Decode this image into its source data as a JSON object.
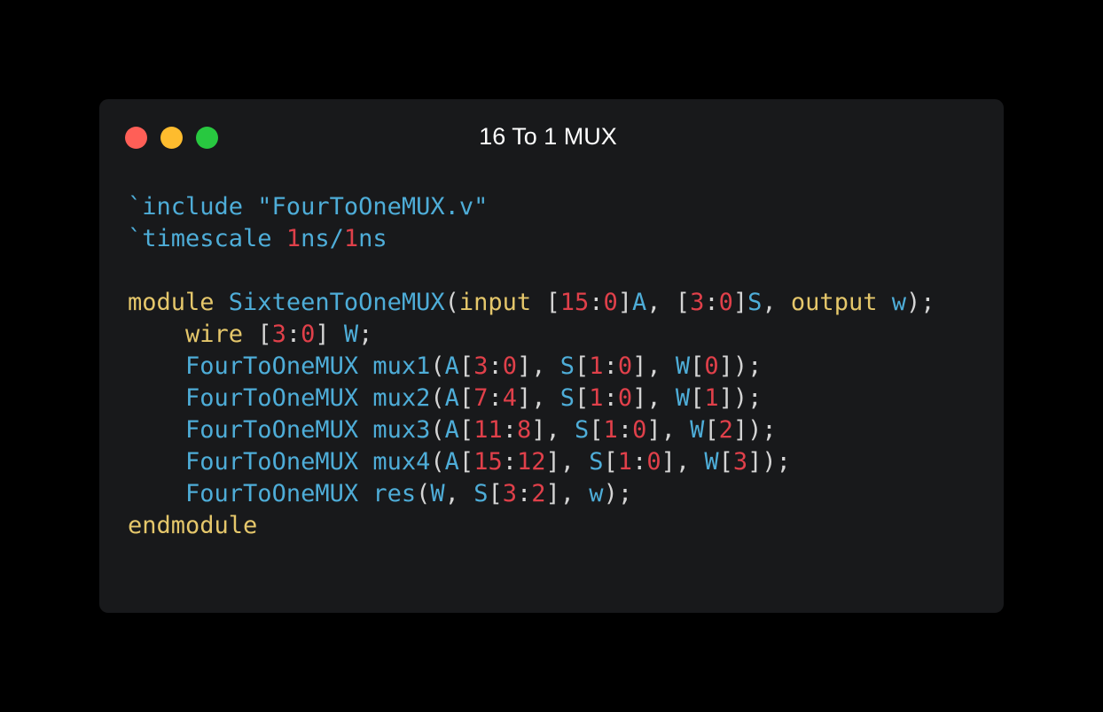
{
  "window": {
    "title": "16 To 1 MUX",
    "controls": {
      "close_color": "#ff5f57",
      "minimize_color": "#febc2e",
      "maximize_color": "#28c840"
    }
  },
  "colors": {
    "kw": "#e5c76b",
    "id": "#4eadd8",
    "num": "#e0404a",
    "punct": "#d4d4d4"
  },
  "code": {
    "language": "verilog",
    "lines": [
      [
        [
          "kw-id",
          "`include \"FourToOneMUX.v\""
        ]
      ],
      [
        [
          "id",
          "`timescale "
        ],
        [
          "num",
          "1"
        ],
        [
          "id",
          "ns/"
        ],
        [
          "num",
          "1"
        ],
        [
          "id",
          "ns"
        ]
      ],
      [],
      [
        [
          "kw",
          "module "
        ],
        [
          "id",
          "SixteenToOneMUX"
        ],
        [
          "punct",
          "("
        ],
        [
          "kw",
          "input "
        ],
        [
          "punct",
          "["
        ],
        [
          "num",
          "15"
        ],
        [
          "punct",
          ":"
        ],
        [
          "num",
          "0"
        ],
        [
          "punct",
          "]"
        ],
        [
          "id",
          "A"
        ],
        [
          "punct",
          ", ["
        ],
        [
          "num",
          "3"
        ],
        [
          "punct",
          ":"
        ],
        [
          "num",
          "0"
        ],
        [
          "punct",
          "]"
        ],
        [
          "id",
          "S"
        ],
        [
          "punct",
          ", "
        ],
        [
          "kw",
          "output "
        ],
        [
          "id",
          "w"
        ],
        [
          "punct",
          ");"
        ]
      ],
      [
        [
          "punct",
          "    "
        ],
        [
          "kw",
          "wire "
        ],
        [
          "punct",
          "["
        ],
        [
          "num",
          "3"
        ],
        [
          "punct",
          ":"
        ],
        [
          "num",
          "0"
        ],
        [
          "punct",
          "] "
        ],
        [
          "id",
          "W"
        ],
        [
          "punct",
          ";"
        ]
      ],
      [
        [
          "punct",
          "    "
        ],
        [
          "id",
          "FourToOneMUX "
        ],
        [
          "id",
          "mux1"
        ],
        [
          "punct",
          "("
        ],
        [
          "id",
          "A"
        ],
        [
          "punct",
          "["
        ],
        [
          "num",
          "3"
        ],
        [
          "punct",
          ":"
        ],
        [
          "num",
          "0"
        ],
        [
          "punct",
          "], "
        ],
        [
          "id",
          "S"
        ],
        [
          "punct",
          "["
        ],
        [
          "num",
          "1"
        ],
        [
          "punct",
          ":"
        ],
        [
          "num",
          "0"
        ],
        [
          "punct",
          "], "
        ],
        [
          "id",
          "W"
        ],
        [
          "punct",
          "["
        ],
        [
          "num",
          "0"
        ],
        [
          "punct",
          "]);"
        ]
      ],
      [
        [
          "punct",
          "    "
        ],
        [
          "id",
          "FourToOneMUX "
        ],
        [
          "id",
          "mux2"
        ],
        [
          "punct",
          "("
        ],
        [
          "id",
          "A"
        ],
        [
          "punct",
          "["
        ],
        [
          "num",
          "7"
        ],
        [
          "punct",
          ":"
        ],
        [
          "num",
          "4"
        ],
        [
          "punct",
          "], "
        ],
        [
          "id",
          "S"
        ],
        [
          "punct",
          "["
        ],
        [
          "num",
          "1"
        ],
        [
          "punct",
          ":"
        ],
        [
          "num",
          "0"
        ],
        [
          "punct",
          "], "
        ],
        [
          "id",
          "W"
        ],
        [
          "punct",
          "["
        ],
        [
          "num",
          "1"
        ],
        [
          "punct",
          "]);"
        ]
      ],
      [
        [
          "punct",
          "    "
        ],
        [
          "id",
          "FourToOneMUX "
        ],
        [
          "id",
          "mux3"
        ],
        [
          "punct",
          "("
        ],
        [
          "id",
          "A"
        ],
        [
          "punct",
          "["
        ],
        [
          "num",
          "11"
        ],
        [
          "punct",
          ":"
        ],
        [
          "num",
          "8"
        ],
        [
          "punct",
          "], "
        ],
        [
          "id",
          "S"
        ],
        [
          "punct",
          "["
        ],
        [
          "num",
          "1"
        ],
        [
          "punct",
          ":"
        ],
        [
          "num",
          "0"
        ],
        [
          "punct",
          "], "
        ],
        [
          "id",
          "W"
        ],
        [
          "punct",
          "["
        ],
        [
          "num",
          "2"
        ],
        [
          "punct",
          "]);"
        ]
      ],
      [
        [
          "punct",
          "    "
        ],
        [
          "id",
          "FourToOneMUX "
        ],
        [
          "id",
          "mux4"
        ],
        [
          "punct",
          "("
        ],
        [
          "id",
          "A"
        ],
        [
          "punct",
          "["
        ],
        [
          "num",
          "15"
        ],
        [
          "punct",
          ":"
        ],
        [
          "num",
          "12"
        ],
        [
          "punct",
          "], "
        ],
        [
          "id",
          "S"
        ],
        [
          "punct",
          "["
        ],
        [
          "num",
          "1"
        ],
        [
          "punct",
          ":"
        ],
        [
          "num",
          "0"
        ],
        [
          "punct",
          "], "
        ],
        [
          "id",
          "W"
        ],
        [
          "punct",
          "["
        ],
        [
          "num",
          "3"
        ],
        [
          "punct",
          "]);"
        ]
      ],
      [
        [
          "punct",
          "    "
        ],
        [
          "id",
          "FourToOneMUX "
        ],
        [
          "id",
          "res"
        ],
        [
          "punct",
          "("
        ],
        [
          "id",
          "W"
        ],
        [
          "punct",
          ", "
        ],
        [
          "id",
          "S"
        ],
        [
          "punct",
          "["
        ],
        [
          "num",
          "3"
        ],
        [
          "punct",
          ":"
        ],
        [
          "num",
          "2"
        ],
        [
          "punct",
          "], "
        ],
        [
          "id",
          "w"
        ],
        [
          "punct",
          ");"
        ]
      ],
      [
        [
          "kw",
          "endmodule"
        ]
      ]
    ]
  }
}
